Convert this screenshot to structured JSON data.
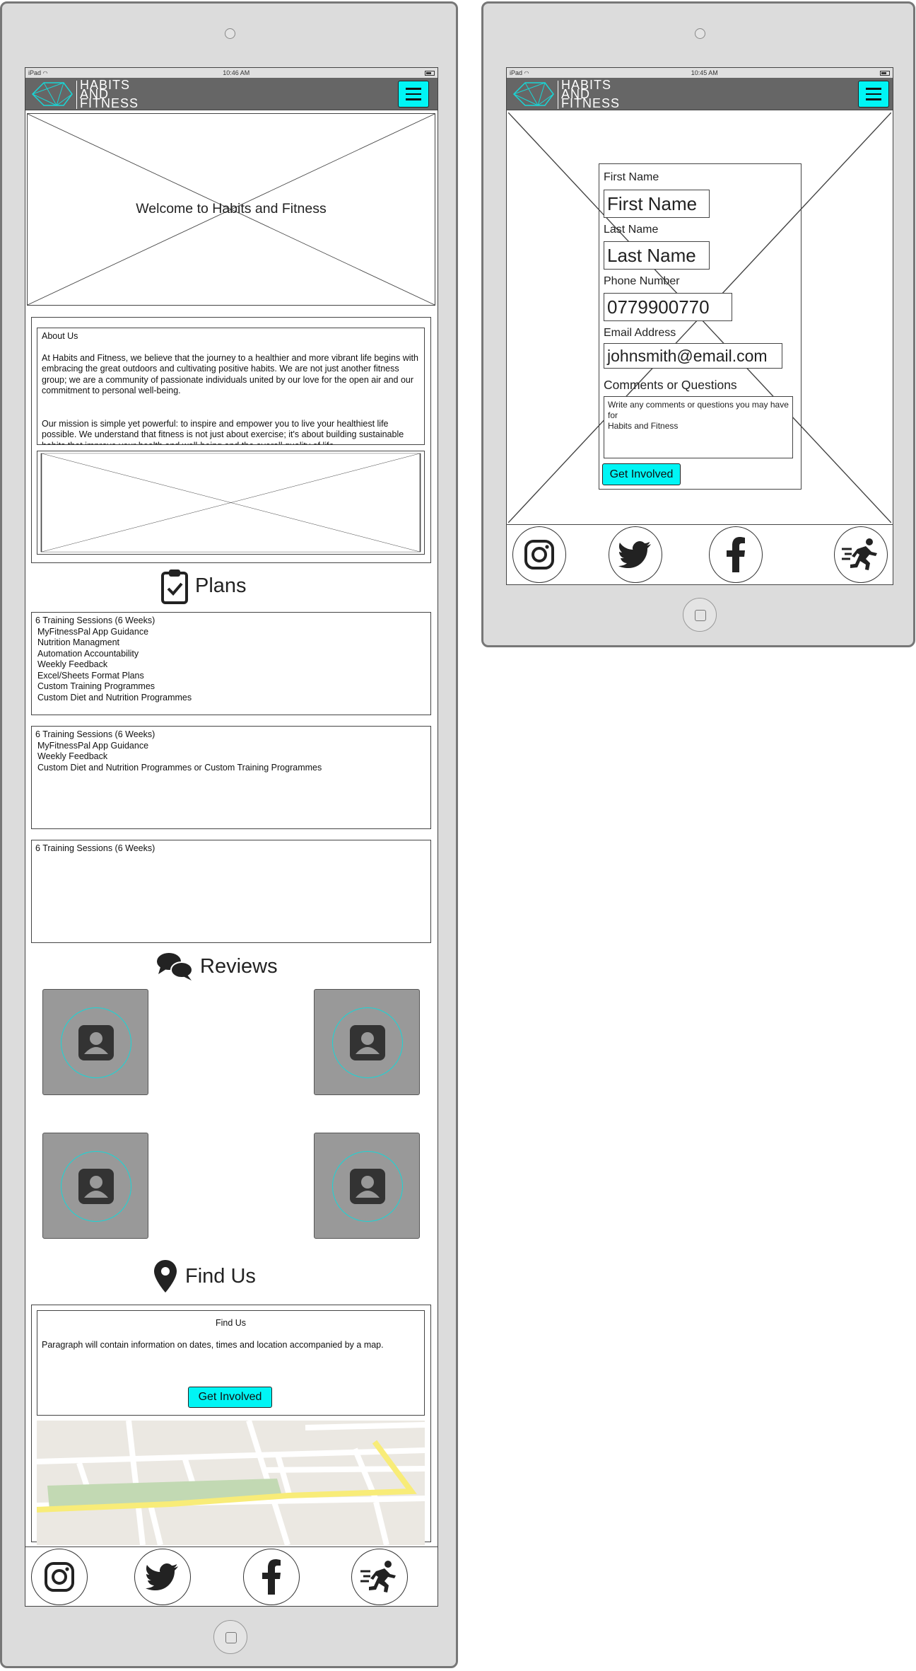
{
  "left_device": {
    "status": {
      "carrier": "iPad",
      "time": "10:46 AM"
    },
    "brand": {
      "line1": "HABITS",
      "line2": "AND",
      "line3": "FITNESS"
    },
    "hero": {
      "text": "Welcome to Habits and Fitness"
    },
    "about": {
      "title": "About Us",
      "para1": "At Habits and Fitness, we believe that the journey to a healthier and more vibrant life begins with embracing the great outdoors and cultivating positive habits. We are not just another fitness group; we are a community of passionate individuals united by our love for the open air and our commitment to personal well-being.",
      "para2": "Our mission is simple yet powerful: to inspire and empower you to live your healthiest life possible. We understand that fitness is not just about exercise; it's about building sustainable habits that improve your health and well-being and the overall quality of life."
    },
    "plans": {
      "heading": "Plans",
      "cards": [
        {
          "title": "6 Training Sessions (6 Weeks)",
          "items": [
            "MyFitnessPal App Guidance",
            "Nutrition Managment",
            "Automation Accountability",
            "Weekly Feedback",
            "Excel/Sheets Format Plans",
            "Custom Training Programmes",
            "Custom Diet and Nutrition Programmes"
          ]
        },
        {
          "title": "6 Training Sessions (6 Weeks)",
          "items": [
            "MyFitnessPal App Guidance",
            "Weekly Feedback",
            "Custom Diet and Nutrition Programmes or Custom Training Programmes"
          ]
        },
        {
          "title": "6 Training Sessions (6 Weeks)",
          "items": []
        }
      ]
    },
    "reviews": {
      "heading": "Reviews"
    },
    "find_us": {
      "heading": "Find Us",
      "title": "Find Us",
      "text": "Paragraph will contain information on dates, times and location accompanied by a map.",
      "button": "Get Involved"
    }
  },
  "right_device": {
    "status": {
      "carrier": "iPad",
      "time": "10:45 AM"
    },
    "brand": {
      "line1": "HABITS",
      "line2": "AND",
      "line3": "FITNESS"
    },
    "form": {
      "first_name_label": "First Name",
      "first_name_value": "First Name",
      "last_name_label": "Last Name",
      "last_name_value": "Last Name",
      "phone_label": "Phone Number",
      "phone_value": "0779900770",
      "email_label": "Email Address",
      "email_value": "johnsmith@email.com",
      "comments_label": "Comments or Questions",
      "comments_line1": "Write any comments or questions you may have for",
      "comments_line2": "Habits and Fitness",
      "submit": "Get Involved"
    }
  },
  "icons": {
    "menu": "hamburger-icon",
    "plans": "clipboard-check-icon",
    "reviews": "comments-icon",
    "find_us": "map-pin-icon",
    "social": [
      "instagram-icon",
      "twitter-icon",
      "facebook-icon",
      "running-icon"
    ]
  },
  "colors": {
    "accent": "#00f5f5",
    "navbar": "#666666",
    "device": "#dcdcdc",
    "review_tile": "#999999"
  }
}
